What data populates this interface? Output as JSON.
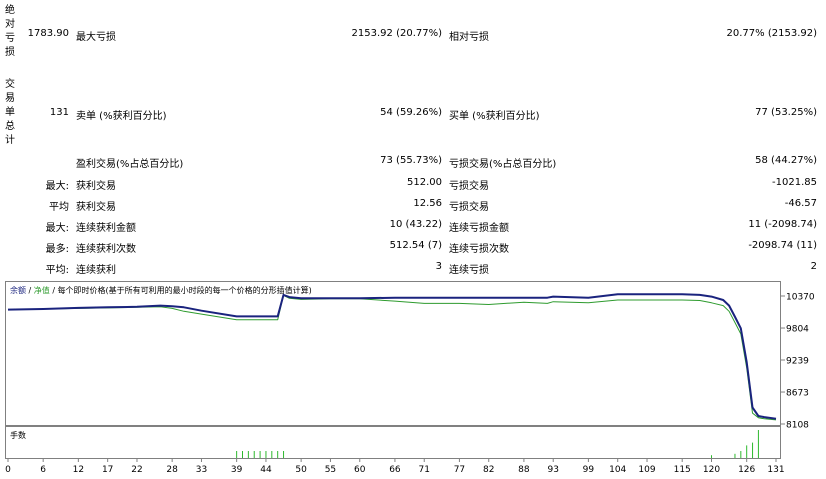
{
  "sections": {
    "drawdown_label": "绝对亏损",
    "trades_label": "交易单总计"
  },
  "rows": {
    "absolute": {
      "value": "1783.90",
      "mid_label": "最大亏损",
      "mid_value": "2153.92 (20.77%)",
      "right_label": "相对亏损",
      "right_value": "20.77% (2153.92)"
    },
    "total": {
      "value": "131",
      "mid_label": "卖单 (%获利百分比)",
      "mid_value": "54 (59.26%)",
      "right_label": "买单 (%获利百分比)",
      "right_value": "77 (53.25%)"
    },
    "profit_loss": {
      "mid_label": "盈利交易(%占总百分比)",
      "mid_value": "73 (55.73%)",
      "right_label": "亏损交易(%占总百分比)",
      "right_value": "58 (44.27%)"
    },
    "largest": {
      "prefix": "最大:",
      "mid_label": "获利交易",
      "mid_value": "512.00",
      "right_label": "亏损交易",
      "right_value": "-1021.85"
    },
    "average": {
      "prefix": "平均",
      "mid_label": "获利交易",
      "mid_value": "12.56",
      "right_label": "亏损交易",
      "right_value": "-46.57"
    },
    "max_consec": {
      "prefix": "最大:",
      "mid_label": "连续获利金额",
      "mid_value": "10 (43.22)",
      "right_label": "连续亏损金额",
      "right_value": "11 (-2098.74)"
    },
    "max_count": {
      "prefix": "最多:",
      "mid_label": "连续获利次数",
      "mid_value": "512.54 (7)",
      "right_label": "连续亏损次数",
      "right_value": "-2098.74 (11)"
    },
    "avg_consec": {
      "prefix": "平均:",
      "mid_label": "连续获利",
      "mid_value": "3",
      "right_label": "连续亏损",
      "right_value": "2"
    }
  },
  "chart_header": {
    "balance": "余额",
    "sep1": " / ",
    "equity": "净值",
    "sep2": " / ",
    "desc": "每个即时价格(基于所有可利用的最小时段的每一个价格的分形插值计算)"
  },
  "volume_label": "手数",
  "colors": {
    "balance": "#1a237e",
    "equity": "#2e9b2e",
    "volume": "#2eb82e",
    "frame": "#808080"
  },
  "chart_data": {
    "type": "line",
    "y_ticks": [
      "10370",
      "9804",
      "9239",
      "8673",
      "8108"
    ],
    "ylim": [
      8108,
      10370
    ],
    "x_ticks": [
      "0",
      "6",
      "12",
      "17",
      "22",
      "28",
      "33",
      "39",
      "44",
      "50",
      "55",
      "60",
      "66",
      "71",
      "77",
      "82",
      "88",
      "93",
      "99",
      "104",
      "109",
      "115",
      "120",
      "126",
      "131"
    ],
    "xlim": [
      0,
      131
    ],
    "series": [
      {
        "name": "余额",
        "x": [
          0,
          6,
          12,
          17,
          22,
          26,
          28,
          30,
          33,
          39,
          44,
          46,
          47,
          48,
          50,
          55,
          60,
          66,
          71,
          77,
          82,
          88,
          92,
          93,
          99,
          104,
          109,
          115,
          118,
          120,
          122,
          123,
          124,
          125,
          126,
          127,
          128,
          129,
          131
        ],
        "y": [
          10130,
          10140,
          10160,
          10170,
          10180,
          10200,
          10190,
          10170,
          10110,
          10010,
          10010,
          10010,
          10390,
          10350,
          10330,
          10330,
          10330,
          10340,
          10340,
          10340,
          10340,
          10340,
          10340,
          10360,
          10340,
          10400,
          10400,
          10400,
          10390,
          10360,
          10300,
          10200,
          10000,
          9800,
          9200,
          8400,
          8250,
          8230,
          8200
        ]
      },
      {
        "name": "净值",
        "x": [
          0,
          6,
          12,
          17,
          22,
          26,
          28,
          30,
          33,
          39,
          44,
          46,
          47,
          48,
          50,
          55,
          60,
          66,
          71,
          77,
          82,
          88,
          92,
          93,
          99,
          104,
          109,
          115,
          118,
          120,
          122,
          123,
          124,
          125,
          126,
          127,
          128,
          129,
          131
        ],
        "y": [
          10130,
          10140,
          10150,
          10160,
          10170,
          10180,
          10150,
          10100,
          10050,
          9950,
          9950,
          9950,
          10380,
          10330,
          10310,
          10320,
          10320,
          10280,
          10240,
          10240,
          10220,
          10260,
          10240,
          10270,
          10250,
          10300,
          10300,
          10300,
          10290,
          10250,
          10200,
          10100,
          9900,
          9700,
          9100,
          8300,
          8220,
          8200,
          8180
        ]
      }
    ],
    "volume_bars": [
      {
        "x": 39,
        "v": 0.25
      },
      {
        "x": 40,
        "v": 0.25
      },
      {
        "x": 41,
        "v": 0.25
      },
      {
        "x": 42,
        "v": 0.25
      },
      {
        "x": 43,
        "v": 0.25
      },
      {
        "x": 44,
        "v": 0.25
      },
      {
        "x": 45,
        "v": 0.25
      },
      {
        "x": 46,
        "v": 0.25
      },
      {
        "x": 47,
        "v": 0.25
      },
      {
        "x": 120,
        "v": 0.1
      },
      {
        "x": 124,
        "v": 0.15
      },
      {
        "x": 125,
        "v": 0.25
      },
      {
        "x": 126,
        "v": 0.45
      },
      {
        "x": 127,
        "v": 0.55
      },
      {
        "x": 128,
        "v": 1.0
      }
    ]
  }
}
